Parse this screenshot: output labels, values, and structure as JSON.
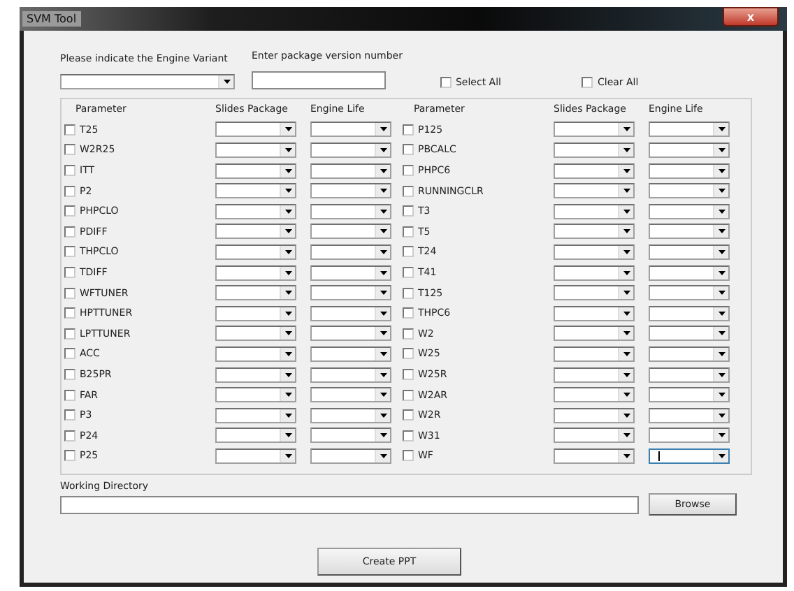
{
  "window": {
    "title": "SVM Tool",
    "close": "x"
  },
  "variant": {
    "label": "Please indicate the Engine Variant"
  },
  "version": {
    "label": "Enter package version number"
  },
  "select_all": {
    "label": "Select All",
    "checked": false
  },
  "clear_all": {
    "label": "Clear All",
    "checked": false
  },
  "groups": [
    {
      "columns": [
        "Parameter",
        "Slides Package",
        "Engine Life"
      ],
      "rows": [
        {
          "label": "T25",
          "checked": false,
          "focused": false
        },
        {
          "label": "W2R25",
          "checked": false,
          "focused": false
        },
        {
          "label": "ITT",
          "checked": false,
          "focused": false
        },
        {
          "label": "P2",
          "checked": false,
          "focused": false
        },
        {
          "label": "PHPCLO",
          "checked": false,
          "focused": false
        },
        {
          "label": "PDIFF",
          "checked": false,
          "focused": false
        },
        {
          "label": "THPCLO",
          "checked": false,
          "focused": false
        },
        {
          "label": "TDIFF",
          "checked": false,
          "focused": false
        },
        {
          "label": "WFTUNER",
          "checked": false,
          "focused": false
        },
        {
          "label": "HPTTUNER",
          "checked": false,
          "focused": false
        },
        {
          "label": "LPTTUNER",
          "checked": false,
          "focused": false
        },
        {
          "label": "ACC",
          "checked": false,
          "focused": false
        },
        {
          "label": "B25PR",
          "checked": false,
          "focused": false
        },
        {
          "label": "FAR",
          "checked": false,
          "focused": false
        },
        {
          "label": "P3",
          "checked": false,
          "focused": false
        },
        {
          "label": "P24",
          "checked": false,
          "focused": false
        },
        {
          "label": "P25",
          "checked": false,
          "focused": false
        }
      ]
    },
    {
      "columns": [
        "Parameter",
        "Slides Package",
        "Engine Life"
      ],
      "rows": [
        {
          "label": "P125",
          "checked": false,
          "focused": false
        },
        {
          "label": "PBCALC",
          "checked": false,
          "focused": false
        },
        {
          "label": "PHPC6",
          "checked": false,
          "focused": false
        },
        {
          "label": "RUNNINGCLR",
          "checked": false,
          "focused": false
        },
        {
          "label": "T3",
          "checked": false,
          "focused": false
        },
        {
          "label": "T5",
          "checked": false,
          "focused": false
        },
        {
          "label": "T24",
          "checked": false,
          "focused": false
        },
        {
          "label": "T41",
          "checked": false,
          "focused": false
        },
        {
          "label": "T125",
          "checked": false,
          "focused": false
        },
        {
          "label": "THPC6",
          "checked": false,
          "focused": false
        },
        {
          "label": "W2",
          "checked": false,
          "focused": false
        },
        {
          "label": "W25",
          "checked": false,
          "focused": false
        },
        {
          "label": "W25R",
          "checked": false,
          "focused": false
        },
        {
          "label": "W2AR",
          "checked": false,
          "focused": false
        },
        {
          "label": "W2R",
          "checked": false,
          "focused": false
        },
        {
          "label": "W31",
          "checked": false,
          "focused": false
        },
        {
          "label": "WF",
          "checked": false,
          "focused": true
        }
      ]
    }
  ],
  "working_directory": {
    "label": "Working Directory"
  },
  "buttons": {
    "browse": "Browse",
    "create": "Create PPT"
  }
}
